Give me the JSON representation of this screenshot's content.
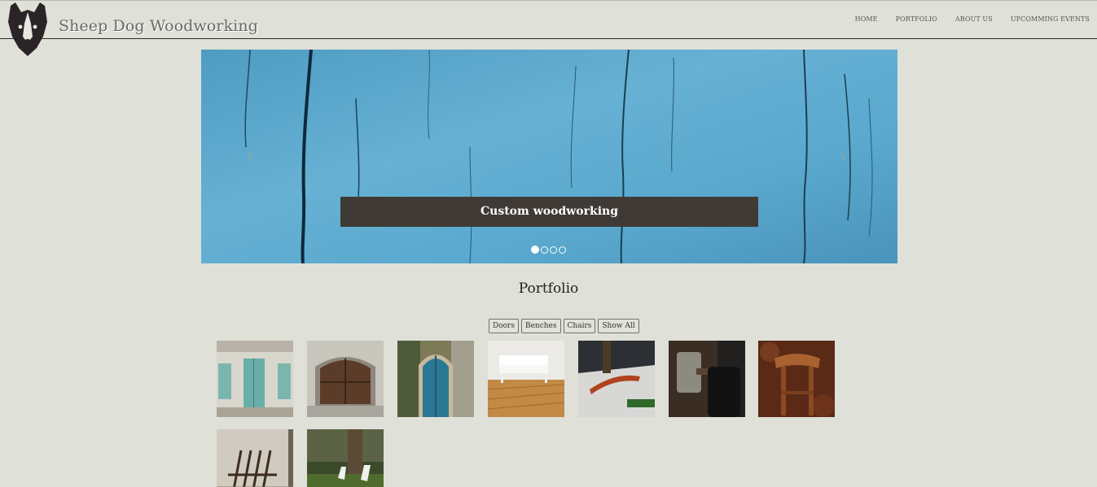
{
  "header": {
    "brand": "Sheep Dog Woodworking",
    "logo_icon": "sheepdog-head-icon"
  },
  "nav": {
    "items": [
      "HOME",
      "PORTFOLIO",
      "ABOUT US",
      "UPCOMMING EVENTS"
    ]
  },
  "carousel": {
    "caption": "Custom woodworking",
    "prev_icon": "chevron-left-icon",
    "next_icon": "chevron-right-icon",
    "slide_count": 4,
    "active_slide": 1,
    "prev_glyph": "‹",
    "next_glyph": "›"
  },
  "portfolio": {
    "title": "Portfolio",
    "filters": [
      "Doors",
      "Benches",
      "Chairs",
      "Show All"
    ],
    "thumbnails": [
      "white-facade-teal-doors-photo",
      "arched-wooden-garage-door-photo",
      "blue-arched-door-photo",
      "white-bench-on-wood-floor-photo",
      "wooden-bench-with-tree-photo",
      "leather-armchairs-photo",
      "wooden-stool-photo",
      "folding-wooden-chairs-photo",
      "white-adirondack-chairs-photo"
    ]
  },
  "colors": {
    "background": "#dfe0d8",
    "caption_bg": "#403a36",
    "carousel_blue": "#5aa6cb",
    "logo": "#2b2427"
  }
}
